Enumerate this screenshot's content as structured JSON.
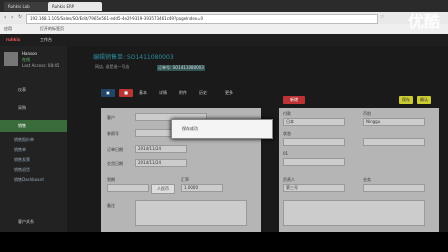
{
  "watermark": "优酷",
  "browser": {
    "tabs": [
      "Ruhkis Lab",
      "Ruhkis ERP"
    ],
    "url": "192.168.1.105/Sales/SO/Edit/7965e561-edd5-4e2f-9319-393573461c49?pageIndex=0",
    "bookmarks": [
      "应用",
      "打开的标签页"
    ]
  },
  "app": {
    "logo": "ruhkis",
    "nav": [
      "工作台"
    ],
    "user": {
      "name": "Hanson",
      "status": "在线",
      "last_access": "Last Access: 08:45"
    }
  },
  "sidebar": {
    "items": [
      "仪表",
      "采购",
      "销售",
      "销售报价单",
      "销售单",
      "销售发票",
      "销售退货",
      "销售Dashboard",
      "客户关系"
    ]
  },
  "document": {
    "title": "编辑销售单: SO1411080003",
    "subtitle": "网店, 谁是谁一号店",
    "order_no": "订单号: SO1411080003",
    "tabs": [
      "基本",
      "详情",
      "附件",
      "历史",
      "更多"
    ],
    "form": {
      "labels": [
        "客户",
        "参照号",
        "订单日期",
        "交货日期",
        "到期",
        "汇率",
        "备注"
      ],
      "values": {
        "date1": "2014/11/24",
        "date2": "2014/11/24",
        "rate": "1.0000",
        "cny_btn": "人民币"
      },
      "right_labels": [
        "付款",
        "币别",
        "状态",
        "负责人",
        "业务"
      ],
      "right_values": {
        "currency": "Ninggu",
        "region": "日本",
        "status": "新增",
        "num": "01",
        "owner": "第三号"
      }
    },
    "toast": "保存成功",
    "action_btn": "保存",
    "ok_btn": "确认"
  },
  "icons": [
    "back-icon",
    "forward-icon",
    "refresh-icon",
    "star-icon",
    "save-icon",
    "print-icon"
  ]
}
